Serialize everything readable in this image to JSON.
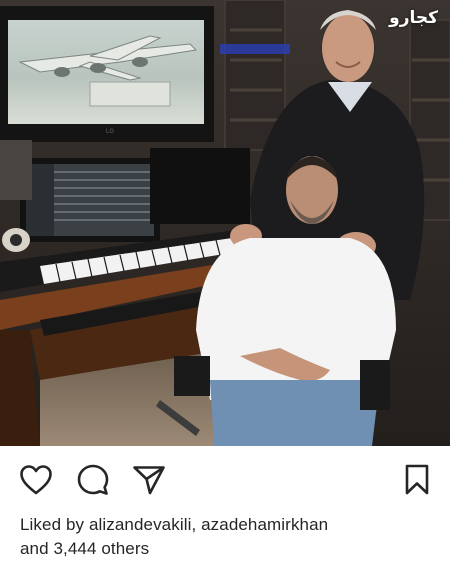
{
  "photo": {
    "alt": "",
    "watermark": "کجارو"
  },
  "actions": {
    "like_icon": "heart-outline-icon",
    "comment_icon": "comment-bubble-icon",
    "share_icon": "paper-plane-icon",
    "save_icon": "bookmark-icon"
  },
  "likes": {
    "prefix": "Liked by",
    "users": "alizandevakili, azadehamirkhan",
    "connector": "and",
    "others": "3,444 others"
  },
  "colors": {
    "icon": "#262626",
    "text": "#262626",
    "background": "#ffffff"
  }
}
